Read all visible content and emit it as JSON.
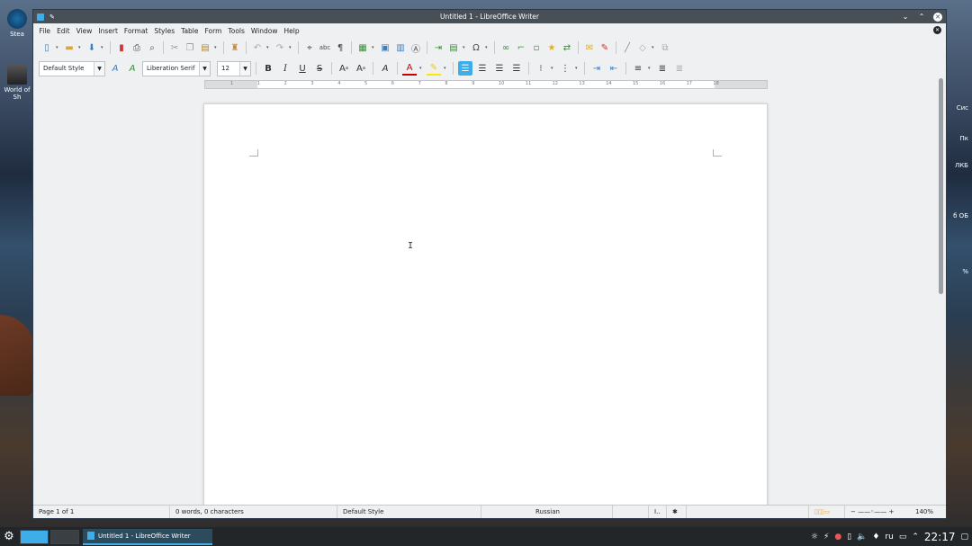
{
  "desktop": {
    "icons": [
      {
        "label": "Stea",
        "icon": "steam-icon"
      },
      {
        "label": "World of Sh",
        "icon": "game-icon"
      }
    ],
    "right_labels": [
      "Сис",
      "Пк",
      "ЛКБ",
      "б ОБ",
      "%"
    ]
  },
  "window": {
    "title": "Untitled 1 - LibreOffice Writer",
    "menu": [
      "File",
      "Edit",
      "View",
      "Insert",
      "Format",
      "Styles",
      "Table",
      "Form",
      "Tools",
      "Window",
      "Help"
    ]
  },
  "formatting": {
    "paragraph_style": "Default Style",
    "font_name": "Liberation Serif",
    "font_size": "12"
  },
  "ruler": {
    "numbers": [
      "1",
      "1",
      "2",
      "3",
      "4",
      "5",
      "6",
      "7",
      "8",
      "9",
      "10",
      "11",
      "12",
      "13",
      "14",
      "15",
      "16",
      "17",
      "18"
    ]
  },
  "status": {
    "page": "Page 1 of 1",
    "words": "0 words, 0 characters",
    "style": "Default Style",
    "language": "Russian",
    "zoom": "140%"
  },
  "taskbar": {
    "task_label": "Untitled 1 - LibreOffice Writer",
    "lang": "ru",
    "time": "22:17"
  },
  "colors": {
    "accent": "#3daee9",
    "titlebar": "#475057",
    "taskbar": "#232629"
  }
}
